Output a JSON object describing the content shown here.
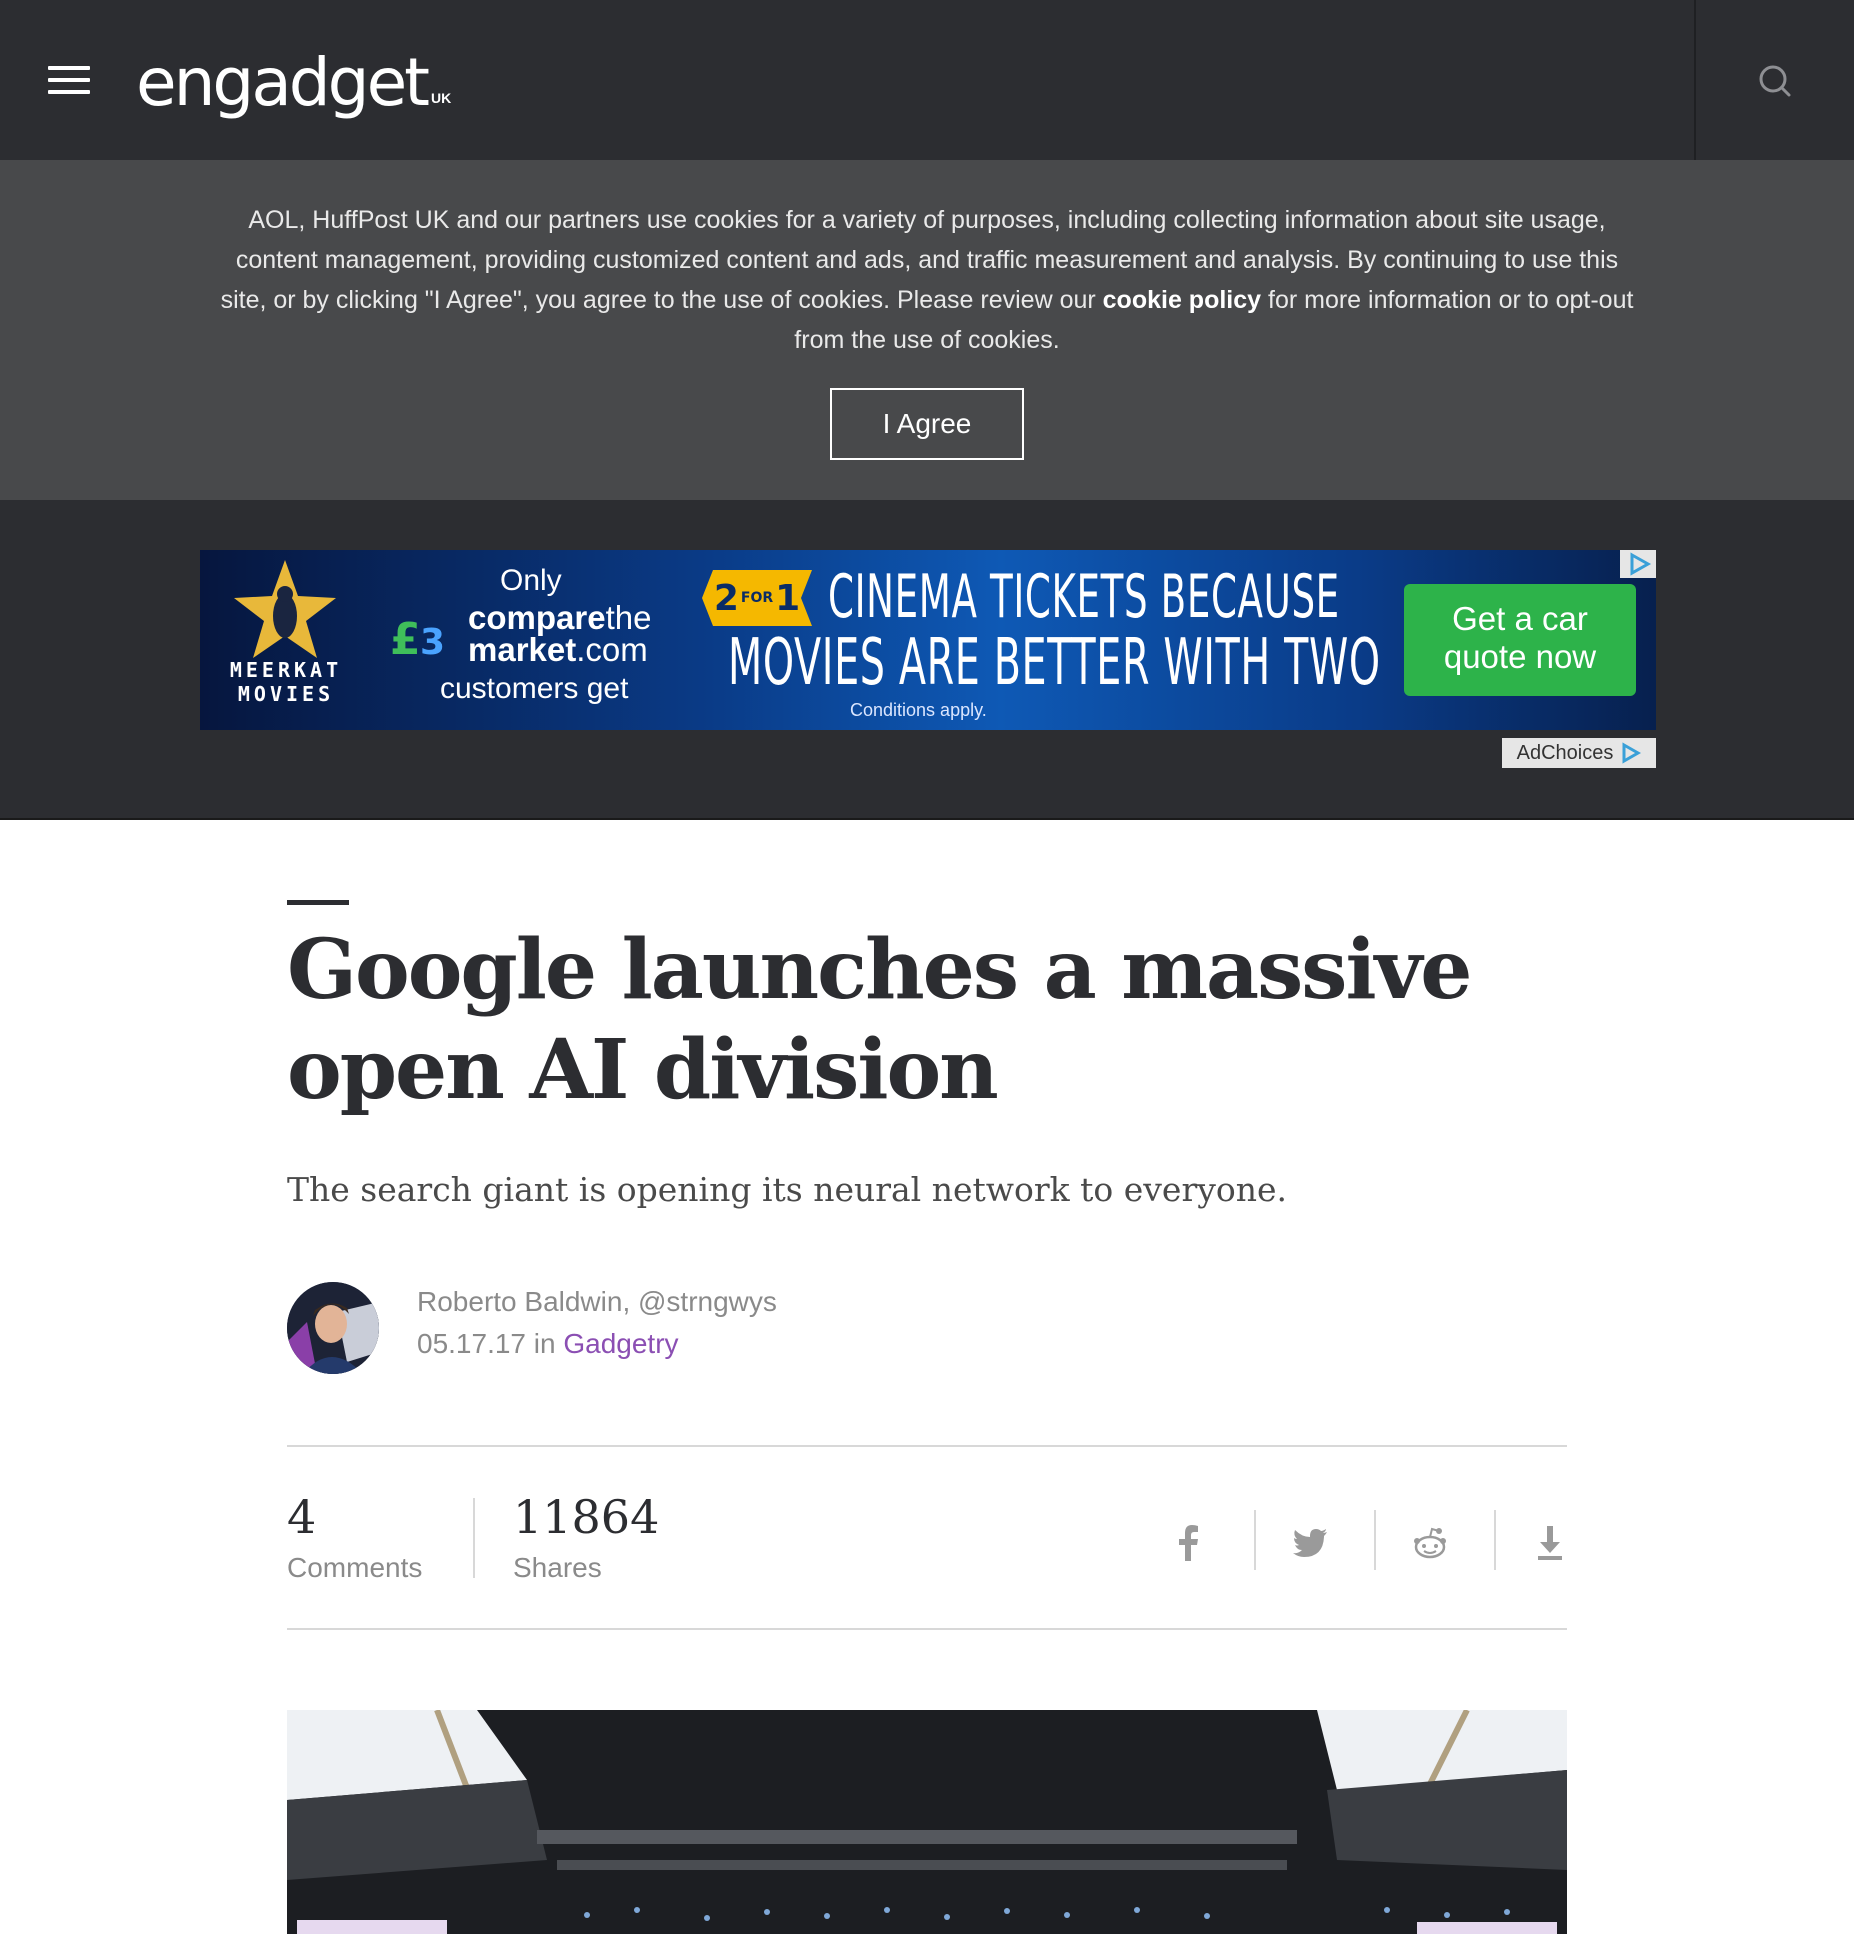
{
  "header": {
    "logo_text": "engadget",
    "logo_region": "UK",
    "menu_icon": "hamburger-icon",
    "search_icon": "search-icon"
  },
  "cookie_banner": {
    "text_before": "AOL, HuffPost UK and our partners use cookies for a variety of purposes, including collecting information about site usage, content management, providing customized content and ads, and traffic measurement and analysis. By continuing to use this site, or by clicking \"I Agree\", you agree to the use of cookies. Please review our ",
    "link_text": "cookie policy",
    "text_after": " for more information or to opt-out from the use of cookies.",
    "button_label": "I Agree"
  },
  "ad": {
    "brand_line1": "MEERKAT",
    "brand_line2": "MOVIES",
    "only": "Only",
    "ctm_bold": "compare",
    "ctm_light": "the",
    "ctm_line2_bold": "market",
    "ctm_line2_light": ".com",
    "customers": "customers get",
    "badge_2": "2",
    "badge_for": "FOR",
    "badge_1": "1",
    "headline1": "CINEMA TICKETS BECAUSE",
    "headline2": "MOVIES ARE BETTER WITH TWO",
    "conditions": "Conditions apply.",
    "cta_line1": "Get a car",
    "cta_line2": "quote now",
    "adchoices": "AdChoices"
  },
  "article": {
    "headline": "Google launches a massive open AI division",
    "subhead": "The search giant is opening its neural network to everyone.",
    "author": "Roberto Baldwin, @strngwys",
    "date": "05.17.17",
    "in_word": "in",
    "category": "Gadgetry",
    "comments_count": "4",
    "comments_label": "Comments",
    "shares_count": "11864",
    "shares_label": "Shares",
    "share_icons": [
      "facebook-icon",
      "twitter-icon",
      "reddit-icon",
      "download-icon"
    ]
  },
  "colors": {
    "header_bg": "#2c2d31",
    "cookie_bg": "#48494b",
    "category_link": "#8b4fb3",
    "ad_cta_green": "#2db34a"
  }
}
